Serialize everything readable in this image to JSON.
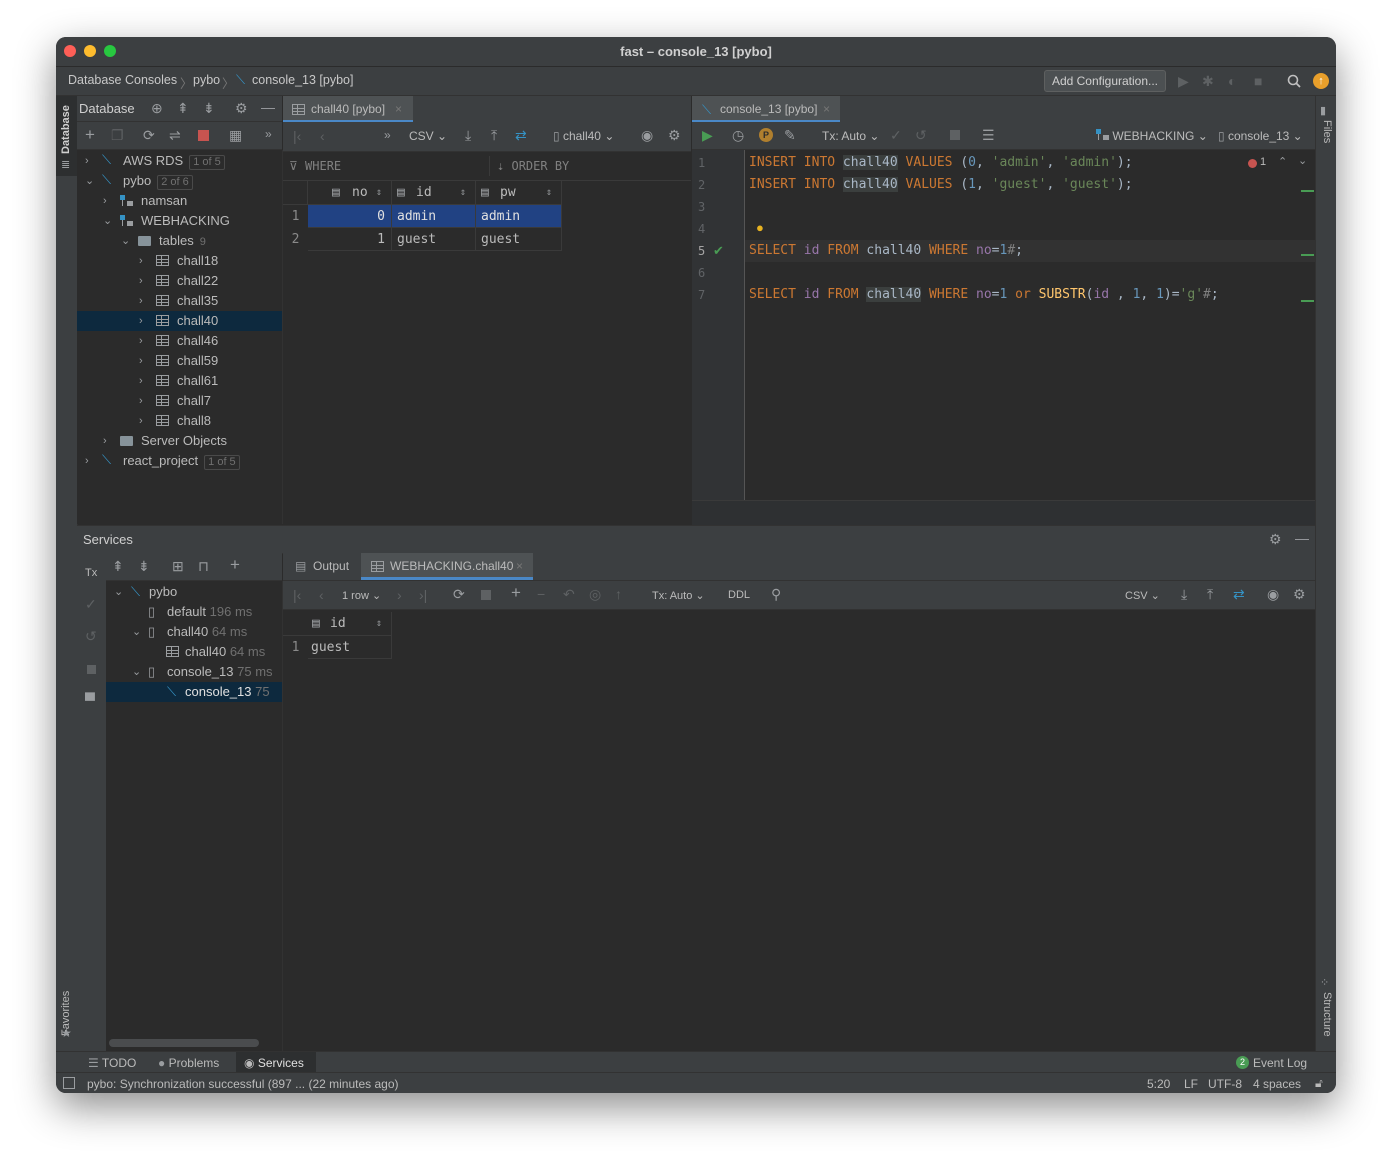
{
  "window": {
    "title": "fast – console_13 [pybo]"
  },
  "navbar": {
    "crumbs": [
      "Database Consoles",
      "pybo",
      "console_13 [pybo]"
    ],
    "add_configuration": "Add Configuration..."
  },
  "left_strip": {
    "database": "Database",
    "favorites": "Favorites"
  },
  "right_strip": {
    "files": "Files",
    "structure": "Structure"
  },
  "database_panel": {
    "title": "Database",
    "tree": [
      {
        "label": "AWS RDS",
        "badge": "1 of 5"
      },
      {
        "label": "pybo",
        "badge": "2 of 6"
      },
      {
        "label": "namsan"
      },
      {
        "label": "WEBHACKING"
      },
      {
        "label": "tables",
        "badge": "9"
      },
      {
        "label": "chall18"
      },
      {
        "label": "chall22"
      },
      {
        "label": "chall35"
      },
      {
        "label": "chall40"
      },
      {
        "label": "chall46"
      },
      {
        "label": "chall59"
      },
      {
        "label": "chall61"
      },
      {
        "label": "chall7"
      },
      {
        "label": "chall8"
      },
      {
        "label": "Server Objects"
      },
      {
        "label": "react_project",
        "badge": "1 of 5"
      }
    ]
  },
  "table_view": {
    "tab": "chall40 [pybo]",
    "format": "CSV",
    "table_selector": "chall40",
    "where": "WHERE",
    "order_by": "ORDER BY",
    "columns": [
      "no",
      "id",
      "pw"
    ],
    "rows": [
      {
        "n": "1",
        "no": "0",
        "id": "admin",
        "pw": "admin"
      },
      {
        "n": "2",
        "no": "1",
        "id": "guest",
        "pw": "guest"
      }
    ]
  },
  "editor": {
    "tab": "console_13 [pybo]",
    "tx": "Tx: Auto",
    "schema": "WEBHACKING",
    "console": "console_13",
    "error_count": "1",
    "line_numbers": [
      "1",
      "2",
      "3",
      "4",
      "5",
      "6",
      "7"
    ]
  },
  "services": {
    "title": "Services",
    "tree": [
      {
        "label": "pybo"
      },
      {
        "label": "default",
        "time": "196 ms"
      },
      {
        "label": "chall40",
        "time": "64 ms"
      },
      {
        "label": "chall40",
        "time": "64 ms"
      },
      {
        "label": "console_13",
        "time": "75 ms"
      },
      {
        "label": "console_13",
        "time": "75"
      }
    ],
    "tabs": [
      "Output",
      "WEBHACKING.chall40"
    ],
    "row_count": "1 row",
    "tx": "Tx: Auto",
    "ddl": "DDL",
    "format": "CSV",
    "result_column": "id",
    "result_rows": [
      {
        "n": "1",
        "id": "guest"
      }
    ]
  },
  "bottom_tabs": {
    "todo": "TODO",
    "problems": "Problems",
    "services": "Services",
    "event_count": "2",
    "event_log": "Event Log"
  },
  "status": {
    "message": "pybo: Synchronization successful (897 ... (22 minutes ago)",
    "position": "5:20",
    "line_sep": "LF",
    "encoding": "UTF-8",
    "indent": "4 spaces"
  },
  "colors": {
    "accent": "#4a88c7",
    "selection": "#0d293e",
    "keyword": "#cc7832",
    "string": "#6a8759",
    "number": "#6897bb"
  }
}
